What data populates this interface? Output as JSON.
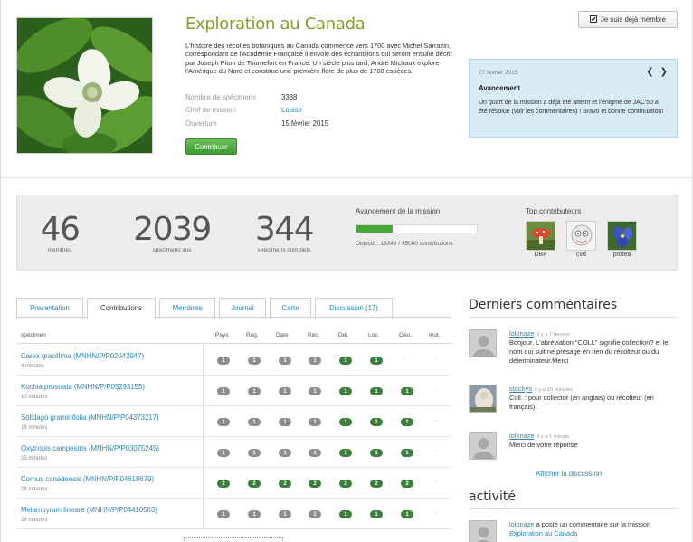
{
  "header": {
    "title": "Exploration au Canada",
    "description": "L'histoire des récoltes botaniques au Canada commence vers 1700 avec Michel Sarrazin, correspondant de l'Académie Française il envoie des échantillons qui seront ensuite décrit par Joseph Piton de Tournefort en France. Un siècle plus tard, André Michaux explore l'Amérique du Nord et constitue une première flore de plus de 1700 espèces.",
    "meta": [
      {
        "label": "Nombre de spécimens",
        "value": "3338"
      },
      {
        "label": "Chef de mission",
        "value": "Louise"
      },
      {
        "label": "Ouverture",
        "value": "15 février 2015"
      }
    ],
    "contribute_label": "Contribuer",
    "member_label": "Je suis déjà membre"
  },
  "news": {
    "date": "27 février 2015",
    "prev": "❮",
    "next": "❯",
    "heading": "Avancement",
    "body": "Un quart de la mission a déjà été atteint et l'énigme de JAC'50 a été résolue (voir les commentaires) ! Bravo et bonne continuation!"
  },
  "stats": {
    "members": {
      "value": "46",
      "label": "membres"
    },
    "seen": {
      "value": "2039",
      "label": "spécimens vus"
    },
    "complete": {
      "value": "344",
      "label": "spécimens complets"
    },
    "progress_label": "Avancement de la mission",
    "progress": 0.297,
    "objective": "Objectif : 13346 / 45000 contributions",
    "top_label": "Top contributeurs",
    "top": [
      {
        "name": "DBF"
      },
      {
        "name": "cvd"
      },
      {
        "name": "protea"
      }
    ]
  },
  "tabs": [
    {
      "label": "Presentation"
    },
    {
      "label": "Contributions"
    },
    {
      "label": "Membres"
    },
    {
      "label": "Journal"
    },
    {
      "label": "Carte"
    },
    {
      "label": "Discussion (17)"
    }
  ],
  "colors": {
    "grey_badge": "#8d8d8d",
    "green_badge": "#3b7f3a",
    "accent": "#2a86b0",
    "title": "#8a9a2c"
  },
  "table": {
    "headers": [
      "spécimen",
      "Pays",
      "Rég.",
      "Date",
      "Réc.",
      "Dét.",
      "Loc.",
      "Géo.",
      "Inut."
    ],
    "rows": [
      {
        "name": "Carex gracillima (MNHN/P/P02042947)",
        "time": "4 minutes",
        "cells": [
          "1",
          "1",
          "1",
          "1",
          "1",
          "1",
          ".",
          "."
        ],
        "green": [
          false,
          false,
          false,
          false,
          true,
          true,
          false,
          false
        ]
      },
      {
        "name": "Kochia prostrata (MNHN/P/P05293155)",
        "time": "10 minutes",
        "cells": [
          "1",
          "1",
          "1",
          "1",
          "1",
          "1",
          "1",
          "."
        ],
        "green": [
          false,
          false,
          false,
          false,
          true,
          true,
          true,
          false
        ]
      },
      {
        "name": "Solidago graminifolia (MNHN/P/P04373217)",
        "time": "15 minutes",
        "cells": [
          "1",
          "1",
          "1",
          "1",
          "1",
          "1",
          "1",
          "."
        ],
        "green": [
          false,
          false,
          false,
          false,
          true,
          true,
          true,
          false
        ]
      },
      {
        "name": "Oxytropis campestris (MNHN/P/P03075245)",
        "time": "25 minutes",
        "cells": [
          "1",
          "1",
          "1",
          "1",
          "1",
          "1",
          "1",
          "."
        ],
        "green": [
          false,
          false,
          false,
          false,
          true,
          true,
          true,
          false
        ]
      },
      {
        "name": "Cornus canadensis (MNHN/P/P04618679)",
        "time": "28 minutes",
        "cells": [
          "2",
          "2",
          "2",
          "2",
          "2",
          "2",
          "2",
          "."
        ],
        "green": [
          true,
          true,
          true,
          true,
          true,
          true,
          true,
          false
        ]
      },
      {
        "name": "Melampyrum lineare (MNHN/P/P04410583)",
        "time": "28 minutes",
        "cells": [
          "1",
          "1",
          "1",
          "1",
          "1",
          "1",
          "1",
          "."
        ],
        "green": [
          false,
          false,
          false,
          false,
          true,
          true,
          true,
          false
        ]
      }
    ]
  },
  "sidebar": {
    "comments_title": "Derniers commentaires",
    "comments": [
      {
        "user": "lolonaze",
        "time": "il y a 7 heures",
        "text": "Bonjour, L'abréviation \"COLL\" signifie collection? et le nom qui suit ne présage en rien du récolteur ou du déterminateur.Merci"
      },
      {
        "user": "stachys",
        "time": "il y a 15 minutes",
        "text": "Coll. : pour collector (en anglais) ou récolteur (en français)."
      },
      {
        "user": "lolonaze",
        "time": "il y a 1 minute",
        "text": "Merci de votre réponse"
      }
    ],
    "show_discussion": "Afficher la discussion",
    "activity_title": "activité",
    "activity": {
      "user": "lolonaze",
      "text": " a posté un commentaire sur la mission ",
      "link": "Exploration au Canada"
    }
  }
}
